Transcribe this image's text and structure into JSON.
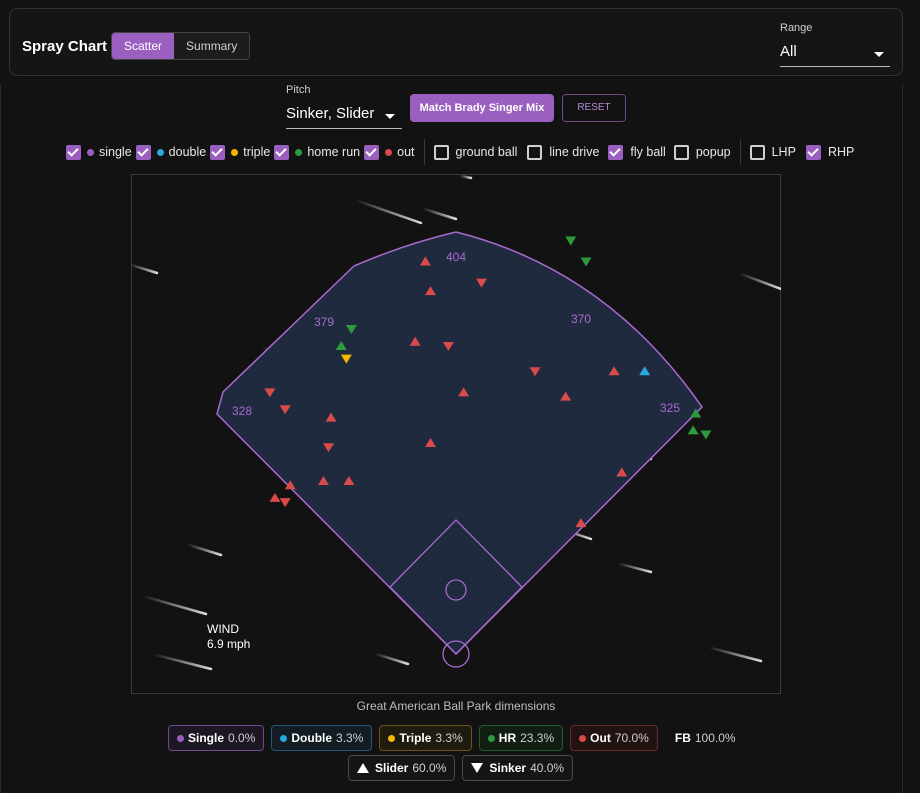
{
  "header": {
    "title": "Spray Chart",
    "view_tabs": [
      {
        "label": "Scatter",
        "active": true
      },
      {
        "label": "Summary",
        "active": false
      }
    ],
    "range": {
      "label": "Range",
      "value": "All"
    }
  },
  "controls": {
    "pitch_label": "Pitch",
    "pitch_value": "Sinker, Slider",
    "match_button": "Match Brady Singer Mix",
    "reset_button": "RESET"
  },
  "filters": {
    "outcomes": [
      {
        "label": "single",
        "checked": true,
        "color": "#9b5fc0"
      },
      {
        "label": "double",
        "checked": true,
        "color": "#29a8e0"
      },
      {
        "label": "triple",
        "checked": true,
        "color": "#f5b800"
      },
      {
        "label": "home run",
        "checked": true,
        "color": "#2e9a3e"
      },
      {
        "label": "out",
        "checked": true,
        "color": "#d94a4a"
      }
    ],
    "batted_ball": [
      {
        "label": "ground ball",
        "checked": false
      },
      {
        "label": "line drive",
        "checked": false
      },
      {
        "label": "fly ball",
        "checked": true
      },
      {
        "label": "popup",
        "checked": false
      }
    ],
    "hand": [
      {
        "label": "LHP",
        "checked": false
      },
      {
        "label": "RHP",
        "checked": true
      }
    ]
  },
  "field": {
    "distances": {
      "lf": "328",
      "lcf": "379",
      "cf": "404",
      "rcf": "370",
      "rf": "325"
    },
    "wind_label": "WIND",
    "wind_speed": "6.9 mph",
    "caption": "Great American Ball Park dimensions",
    "outline_color": "#a96ad0",
    "fill_color": "#1f2a3e"
  },
  "chart_data": {
    "type": "scatter",
    "title": "Spray Chart",
    "xlabel": "",
    "ylabel": "",
    "units": "normalized field position (home plate = 0,0; x toward first-base side, y toward center field)",
    "series": [
      {
        "name": "Out",
        "color": "#d94a4a",
        "points": [
          [
            -0.12,
            0.93,
            "up"
          ],
          [
            -0.1,
            0.86,
            "up"
          ],
          [
            0.1,
            0.88,
            "down"
          ],
          [
            -0.16,
            0.74,
            "up"
          ],
          [
            -0.03,
            0.73,
            "down"
          ],
          [
            0.03,
            0.62,
            "up"
          ],
          [
            0.31,
            0.67,
            "down"
          ],
          [
            0.62,
            0.67,
            "up"
          ],
          [
            0.43,
            0.61,
            "up"
          ],
          [
            -0.73,
            0.62,
            "down"
          ],
          [
            -0.67,
            0.58,
            "down"
          ],
          [
            -0.49,
            0.56,
            "up"
          ],
          [
            -0.1,
            0.5,
            "up"
          ],
          [
            -0.5,
            0.49,
            "down"
          ],
          [
            -0.52,
            0.41,
            "up"
          ],
          [
            -0.42,
            0.41,
            "up"
          ],
          [
            -0.65,
            0.4,
            "up"
          ],
          [
            -0.71,
            0.37,
            "up"
          ],
          [
            -0.67,
            0.36,
            "down"
          ],
          [
            0.65,
            0.43,
            "up"
          ],
          [
            0.49,
            0.31,
            "up"
          ]
        ]
      },
      {
        "name": "Home Run",
        "color": "#2e9a3e",
        "points": [
          [
            -0.41,
            0.77,
            "down"
          ],
          [
            -0.45,
            0.73,
            "up"
          ],
          [
            0.45,
            0.98,
            "down"
          ],
          [
            0.51,
            0.93,
            "down"
          ],
          [
            0.94,
            0.57,
            "up"
          ],
          [
            0.93,
            0.53,
            "up"
          ],
          [
            0.98,
            0.52,
            "down"
          ]
        ]
      },
      {
        "name": "Double",
        "color": "#29a8e0",
        "points": [
          [
            0.74,
            0.67,
            "up"
          ]
        ]
      },
      {
        "name": "Triple",
        "color": "#f5b800",
        "points": [
          [
            -0.43,
            0.7,
            "down"
          ]
        ]
      }
    ]
  },
  "legend": {
    "outcomes": [
      {
        "label": "Single",
        "pct": "0.0%",
        "color": "#9b5fc0",
        "border": "#6e4a88",
        "bg": "#1d1724"
      },
      {
        "label": "Double",
        "pct": "3.3%",
        "color": "#29a8e0",
        "border": "#1f5a75",
        "bg": "#121c22"
      },
      {
        "label": "Triple",
        "pct": "3.3%",
        "color": "#f5b800",
        "border": "#6a5512",
        "bg": "#1f1b10"
      },
      {
        "label": "HR",
        "pct": "23.3%",
        "color": "#2e9a3e",
        "border": "#255a2c",
        "bg": "#121d14"
      },
      {
        "label": "Out",
        "pct": "70.0%",
        "color": "#d94a4a",
        "border": "#6a2a2a",
        "bg": "#221313"
      }
    ],
    "fb": {
      "label": "FB",
      "pct": "100.0%"
    },
    "pitches": [
      {
        "label": "Slider",
        "pct": "60.0%",
        "shape": "up"
      },
      {
        "label": "Sinker",
        "pct": "40.0%",
        "shape": "down"
      }
    ]
  }
}
